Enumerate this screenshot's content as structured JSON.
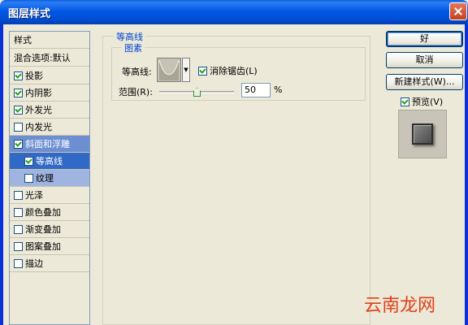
{
  "window": {
    "title": "图层样式"
  },
  "style_list": {
    "header": "样式",
    "blend_options": "混合选项:默认",
    "items": [
      {
        "label": "投影",
        "checked": true
      },
      {
        "label": "内阴影",
        "checked": true
      },
      {
        "label": "外发光",
        "checked": true
      },
      {
        "label": "内发光",
        "checked": false
      },
      {
        "label": "斜面和浮雕",
        "checked": true
      },
      {
        "label": "等高线",
        "checked": true
      },
      {
        "label": "纹理",
        "checked": false
      },
      {
        "label": "光泽",
        "checked": false
      },
      {
        "label": "颜色叠加",
        "checked": false
      },
      {
        "label": "渐变叠加",
        "checked": false
      },
      {
        "label": "图案叠加",
        "checked": false
      },
      {
        "label": "描边",
        "checked": false
      }
    ]
  },
  "contour_panel": {
    "group_title": "等高线",
    "subgroup_title": "图素",
    "contour_label": "等高线:",
    "anti_alias_label": "消除锯齿(L)",
    "anti_alias_checked": true,
    "range_label": "范围(R):",
    "range_value": "50",
    "range_unit": "%"
  },
  "buttons": {
    "ok": "好",
    "cancel": "取消",
    "new_style": "新建样式(W)...",
    "preview_label": "预览(V)",
    "preview_checked": true
  },
  "watermark": "云南龙网"
}
